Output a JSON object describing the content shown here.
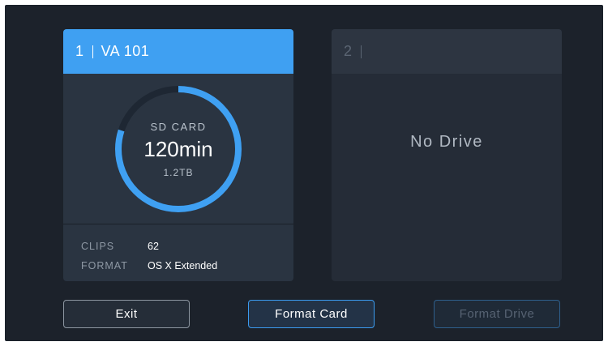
{
  "slot1": {
    "number": "1",
    "name": "VA 101",
    "media_type": "SD CARD",
    "remaining_time": "120min",
    "capacity": "1.2TB",
    "usage_fraction": 0.8,
    "clips_label": "CLIPS",
    "clips_value": "62",
    "format_label": "FORMAT",
    "format_value": "OS X Extended"
  },
  "slot2": {
    "number": "2",
    "status": "No Drive"
  },
  "buttons": {
    "exit": "Exit",
    "format_card": "Format Card",
    "format_drive": "Format Drive"
  },
  "colors": {
    "accent": "#3fa0f2",
    "background": "#1c222b",
    "panel_active": "#2a3441",
    "panel_empty": "#252c37"
  }
}
